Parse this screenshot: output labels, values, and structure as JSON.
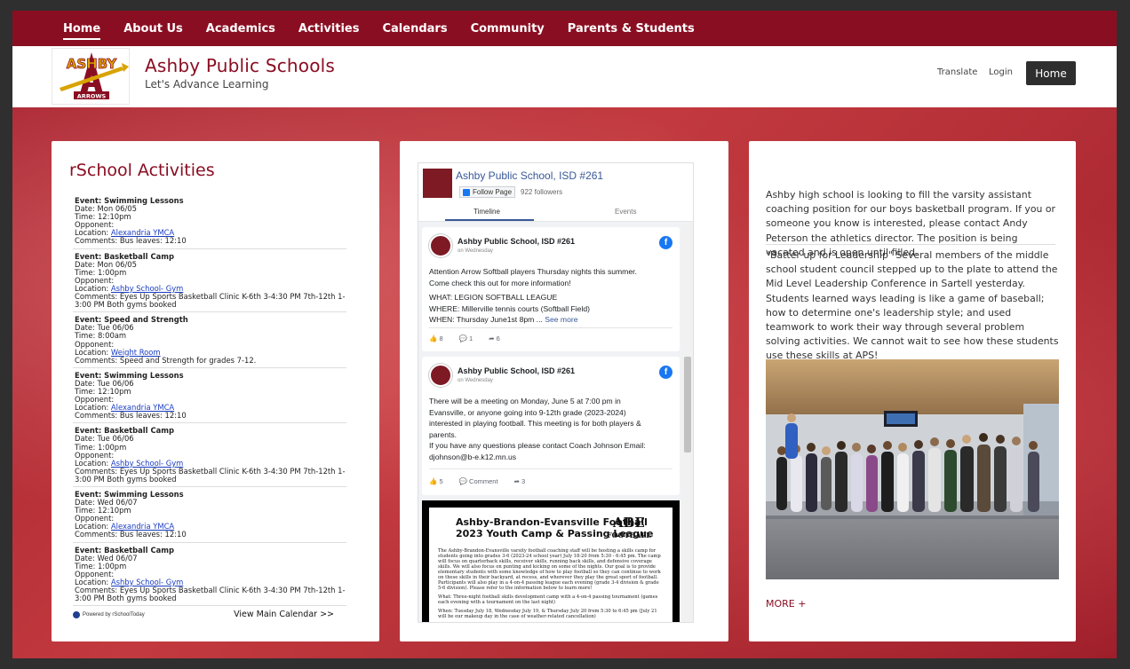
{
  "nav": {
    "items": [
      "Home",
      "About Us",
      "Academics",
      "Activities",
      "Calendars",
      "Community",
      "Parents & Students"
    ]
  },
  "header": {
    "logo_text_top": "ASHBY",
    "logo_text_bottom": "ARROWS",
    "site_title": "Ashby Public Schools",
    "site_subtitle": "Let's Advance Learning",
    "translate": "Translate",
    "login": "Login",
    "home_button": "Home"
  },
  "rschool": {
    "title": "rSchool Activities",
    "events": [
      {
        "event": "Event: Swimming Lessons",
        "date": "Date: Mon 06/05",
        "time": "Time: 12:10pm",
        "opponent": "Opponent:",
        "location_label": "Location: ",
        "location": "Alexandria YMCA",
        "comments": "Comments: Bus leaves: 12:10"
      },
      {
        "event": "Event: Basketball Camp",
        "date": "Date: Mon 06/05",
        "time": "Time: 1:00pm",
        "opponent": "Opponent:",
        "location_label": "Location: ",
        "location": "Ashby School- Gym",
        "comments": "Comments: Eyes Up Sports Basketball Clinic K-6th 3-4:30 PM 7th-12th 1-3:00 PM Both gyms booked"
      },
      {
        "event": "Event: Speed and Strength",
        "date": "Date: Tue 06/06",
        "time": "Time: 8:00am",
        "opponent": "Opponent:",
        "location_label": "Location: ",
        "location": "Weight Room",
        "comments": "Comments: Speed and Strength for grades 7-12."
      },
      {
        "event": "Event: Swimming Lessons",
        "date": "Date: Tue 06/06",
        "time": "Time: 12:10pm",
        "opponent": "Opponent:",
        "location_label": "Location: ",
        "location": "Alexandria YMCA",
        "comments": "Comments: Bus leaves: 12:10"
      },
      {
        "event": "Event: Basketball Camp",
        "date": "Date: Tue 06/06",
        "time": "Time: 1:00pm",
        "opponent": "Opponent:",
        "location_label": "Location: ",
        "location": "Ashby School- Gym",
        "comments": "Comments: Eyes Up Sports Basketball Clinic K-6th 3-4:30 PM 7th-12th 1-3:00 PM Both gyms booked"
      },
      {
        "event": "Event: Swimming Lessons",
        "date": "Date: Wed 06/07",
        "time": "Time: 12:10pm",
        "opponent": "Opponent:",
        "location_label": "Location: ",
        "location": "Alexandria YMCA",
        "comments": "Comments: Bus leaves: 12:10"
      },
      {
        "event": "Event: Basketball Camp",
        "date": "Date: Wed 06/07",
        "time": "Time: 1:00pm",
        "opponent": "Opponent:",
        "location_label": "Location: ",
        "location": "Ashby School- Gym",
        "comments": "Comments: Eyes Up Sports Basketball Clinic K-6th 3-4:30 PM 7th-12th 1-3:00 PM Both gyms booked"
      }
    ],
    "powered_by": "Powered by rSchoolToday",
    "view_calendar": "View Main Calendar >>"
  },
  "facebook": {
    "page_name": "Ashby Public School, ISD #261",
    "follow_label": "Follow Page",
    "followers": "922 followers",
    "tab_timeline": "Timeline",
    "tab_events": "Events",
    "posts": [
      {
        "name": "Ashby Public School, ISD #261",
        "when": "on Wednesday",
        "lines": [
          "Attention Arrow Softball players Thursday nights this summer.",
          "Come check this out for more information!",
          "",
          "WHAT: LEGION SOFTBALL LEAGUE",
          "WHERE: Millerville tennis courts (Softball Field)",
          "WHEN: Thursday June1st 8pm ..."
        ],
        "see_more": "See more",
        "likes": "8",
        "comments": "1",
        "shares": "6"
      },
      {
        "name": "Ashby Public School, ISD #261",
        "when": "on Wednesday",
        "lines": [
          "There will be a meeting on Monday, June 5 at 7:00 pm in",
          "Evansville, or anyone going into 9-12th grade (2023-2024)",
          "interested in playing football. This meeting is for both players &",
          "parents.",
          "If you have any questions please contact Coach Johnson Email:",
          "djohnson@b-e.k12.mn.us"
        ],
        "likes": "5",
        "comments_label": "Comment",
        "shares": "3"
      }
    ],
    "flyer": {
      "title_line1": "Ashby-Brandon-Evansville Football",
      "title_line2": "2023 Youth Camp & Passing League",
      "abe": "ABE",
      "abe_sub": "FOOTBALL",
      "body": "The Ashby-Brandon-Evansville varsity football coaching staff will be hosting a skills camp for students going into grades 3-6 (2023-24 school year) July 18-20 from 5:30 - 6:45 pm. The camp will focus on quarterback skills, receiver skills, running back skills, and defensive coverage skills. We will also focus on punting and kicking on some of the nights. Our goal is to provide elementary students with some knowledge of how to play football so they can continue to work on these skills in their backyard, at recess, and wherever they play the great sport of football. Participants will also play in a 4-on-4 passing league each evening (grade 3-4 division & grade 5-6 division). Please refer to the information below to learn more!",
      "what": "What: Three-night football skills development camp with a 4-on-4 passing tournament (games each evening with a tournament on the last night)",
      "when": "When: Tuesday July 18, Wednesday July 19, & Thursday July 20 from 5:30 to 6:45 pm (July 21 will be our makeup day in the case of weather-related cancellation)"
    }
  },
  "news": {
    "item1": "Ashby high school is looking to fill the varsity assistant coaching position for our boys basketball program. If you or someone you know is interested, please contact Andy Peterson the athletics director. The position is being vacated and is open until filled.",
    "item2": "\"Batter up for Leadership\" Several members of the middle school student council stepped up to the plate to attend the Mid Level Leadership Conference in Sartell yesterday. Students learned ways leading is like a game of baseball; how to determine one's leadership style; and used teamwork to work their way through several problem solving activities. We cannot wait to see how these students use these skills at APS!",
    "more": "MORE +"
  },
  "colors": {
    "brand": "#8a0e22",
    "link": "#1a3cc0",
    "facebook": "#1877f2"
  }
}
